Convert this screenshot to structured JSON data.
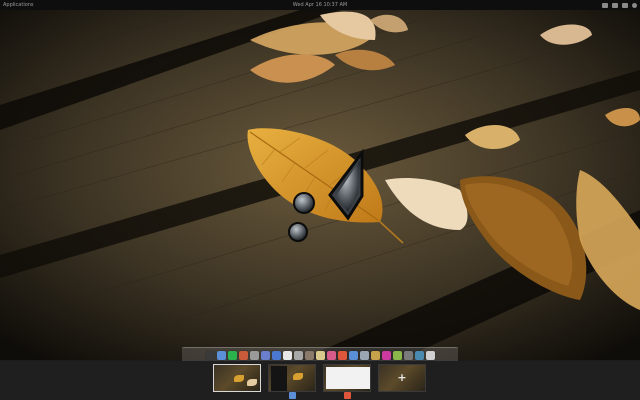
{
  "topbar": {
    "applications_label": "Applications",
    "clock": "Wed Apr 16 10:37 AM",
    "indicators": [
      "network-icon",
      "volume-icon",
      "battery-icon",
      "power-icon"
    ]
  },
  "desktop": {
    "wallpaper": "autumn-leaves-on-wooden-planks",
    "cursor": "busy-cursor-icon"
  },
  "dock": {
    "icons": [
      {
        "name": "terminal-icon",
        "color": "#3a3a3a"
      },
      {
        "name": "finder-icon",
        "color": "#5b8fd8"
      },
      {
        "name": "download-icon",
        "color": "#2bb24c"
      },
      {
        "name": "settings-icon",
        "color": "#c95b3a"
      },
      {
        "name": "camera-icon",
        "color": "#9a9a9a"
      },
      {
        "name": "network-icon",
        "color": "#6a7fcc"
      },
      {
        "name": "browser-icon",
        "color": "#4a78d0"
      },
      {
        "name": "document-icon",
        "color": "#e8e8e8"
      },
      {
        "name": "clock-icon",
        "color": "#a8a8a8"
      },
      {
        "name": "photos-icon",
        "color": "#8a7a6a"
      },
      {
        "name": "notes-icon",
        "color": "#d9c98a"
      },
      {
        "name": "music-icon",
        "color": "#d65a8a"
      },
      {
        "name": "media-icon",
        "color": "#e0563a"
      },
      {
        "name": "store-icon",
        "color": "#5a8ed6"
      },
      {
        "name": "tools-icon",
        "color": "#9aa6b2"
      },
      {
        "name": "mail-icon",
        "color": "#c8a24a"
      },
      {
        "name": "itunes-icon",
        "color": "#cc3aa0"
      },
      {
        "name": "chat-icon",
        "color": "#8ab84a"
      },
      {
        "name": "disk-icon",
        "color": "#7a7a7a"
      },
      {
        "name": "calculator-icon",
        "color": "#4a8ab0"
      },
      {
        "name": "trash-icon",
        "color": "#d0d0d0"
      }
    ]
  },
  "workspaces": [
    {
      "label": "workspace-1",
      "active": true,
      "badge_color": ""
    },
    {
      "label": "workspace-2",
      "active": false,
      "badge_color": "#5b8fd8"
    },
    {
      "label": "workspace-3",
      "active": false,
      "badge_color": "#e0563a"
    },
    {
      "label": "workspace-new",
      "active": false,
      "badge_color": "",
      "plus": "+"
    }
  ]
}
